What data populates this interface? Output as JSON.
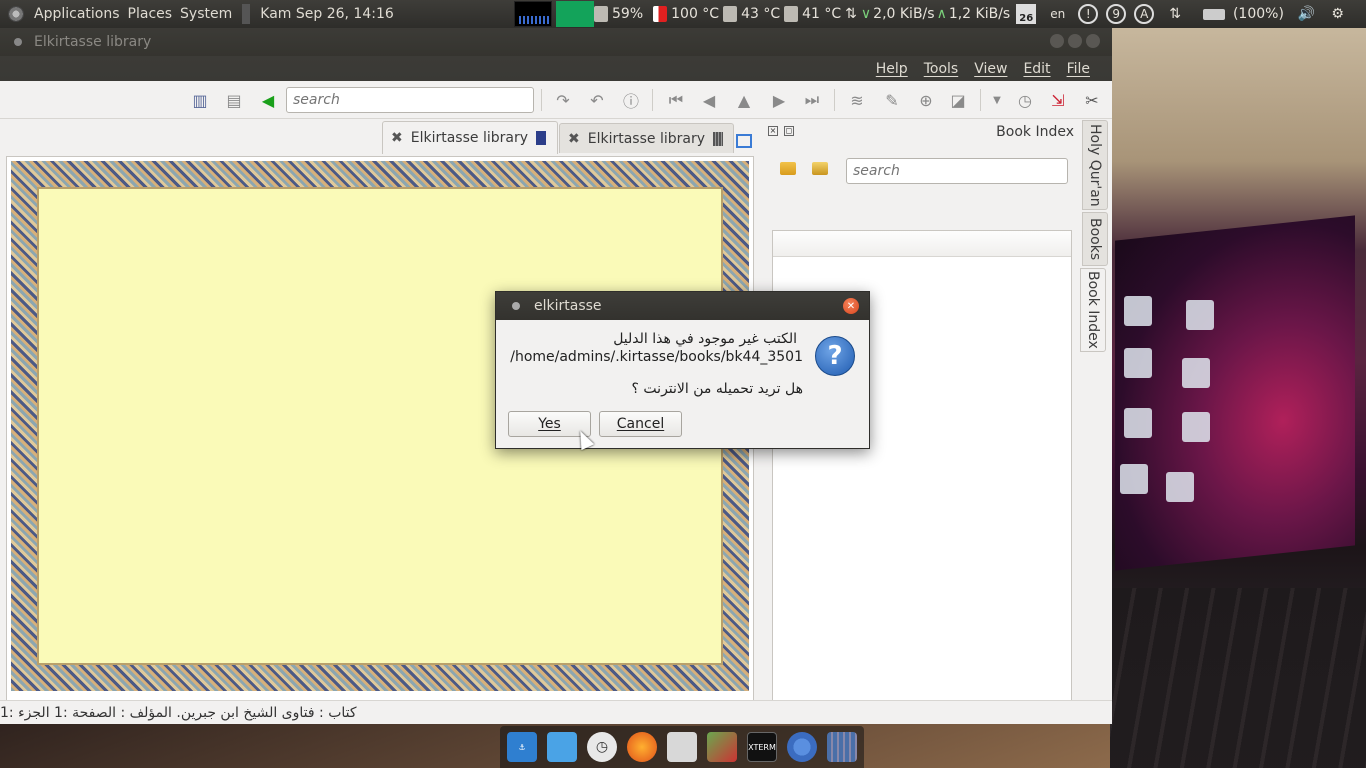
{
  "top_panel": {
    "applications": "Applications",
    "places": "Places",
    "system": "System",
    "clock": "Kam Sep 26, 14:16",
    "cpu_percent": "59%",
    "temp1": "100 °C",
    "temp2": "43 °C",
    "temp3": "41 °C",
    "net_down": "2,0 KiB/s",
    "net_up": "1,2 KiB/s",
    "calendar_day": "26",
    "keyboard_layout": "en",
    "badge_count": "9",
    "badge_letter": "A",
    "battery": "(100%)"
  },
  "window": {
    "title": "Elkirtasse library",
    "menu": [
      "Help",
      "Tools",
      "View",
      "Edit",
      "File"
    ]
  },
  "toolbar": {
    "search_placeholder": "search"
  },
  "tabs": [
    {
      "label": "Elkirtasse library"
    },
    {
      "label": "Elkirtasse library"
    }
  ],
  "dock": {
    "title": "Book Index",
    "search_placeholder": "search",
    "side_tabs": [
      "Holy Qur'an",
      "Books",
      "Book Index"
    ]
  },
  "statusbar": {
    "text": "كتاب : فتاوى الشيخ ابن جبرين.  المؤلف : الصفحة :1  الجزء :1"
  },
  "dialog": {
    "title": "elkirtasse",
    "message_line1": "الكتب غير موجود في هذا الدليل",
    "message_path": "/home/admins/.kirtasse/books/bk44_3501",
    "message_question": "هل تريد تحميله من الانترنت ؟",
    "yes_label": "Yes",
    "cancel_label": "Cancel"
  },
  "colors": {
    "panel_bg": "#3c3b37",
    "window_bg": "#f2f1f0",
    "page_bg": "#fafab8",
    "dialog_close": "#e05a2b",
    "question_icon": "#2f6fc9"
  }
}
